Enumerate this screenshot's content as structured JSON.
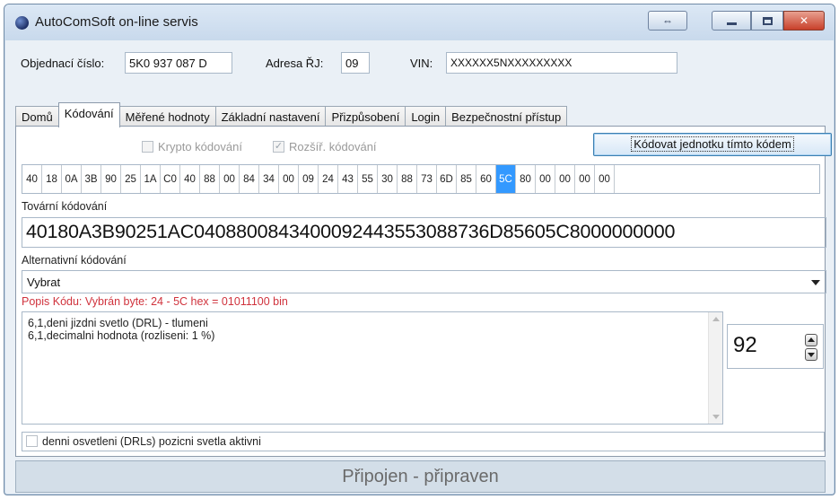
{
  "window": {
    "title": "AutoComSoft on-line servis"
  },
  "title_buttons": {
    "restore_glyph": "⇔",
    "close_glyph": "✕"
  },
  "header": {
    "order_label": "Objednací číslo:",
    "order_value": "5K0 937 087 D",
    "unit_label": "Adresa ŘJ:",
    "unit_value": "09",
    "vin_label": "VIN:",
    "vin_value": "XXXXXX5NXXXXXXXXX"
  },
  "tabs": [
    {
      "label": "Domů",
      "active": false
    },
    {
      "label": "Kódování",
      "active": true
    },
    {
      "label": "Měřené hodnoty",
      "active": false
    },
    {
      "label": "Základní nastavení",
      "active": false
    },
    {
      "label": "Přizpůsobení",
      "active": false
    },
    {
      "label": "Login",
      "active": false
    },
    {
      "label": "Bezpečnostní přístup",
      "active": false
    }
  ],
  "coding": {
    "crypto_label": "Krypto kódování",
    "extended_label": "Rozšíř. kódování",
    "apply_button": "Kódovat jednotku tímto kódem",
    "bytes": [
      "40",
      "18",
      "0A",
      "3B",
      "90",
      "25",
      "1A",
      "C0",
      "40",
      "88",
      "00",
      "84",
      "34",
      "00",
      "09",
      "24",
      "43",
      "55",
      "30",
      "88",
      "73",
      "6D",
      "85",
      "60",
      "5C",
      "80",
      "00",
      "00",
      "00",
      "00"
    ],
    "selected_byte": "5C",
    "factory_label": "Tovární kódování",
    "factory_value": "40180A3B90251AC0408800843400092443553088736D85605C8000000000",
    "alt_label": "Alternativní kódování",
    "alt_selected": "Vybrat",
    "description": "Popis Kódu: Vybrán byte: 24 - 5C hex = 01011100 bin",
    "memo_lines": [
      "6,1,deni jizdni svetlo (DRL) - tlumeni",
      "6,1,decimalni hodnota (rozliseni: 1 %)"
    ],
    "spin_value": "92",
    "bottom_checkbox": "denni osvetleni (DRLs) pozicni svetla aktivni"
  },
  "status": {
    "text": "Připojen - připraven"
  }
}
